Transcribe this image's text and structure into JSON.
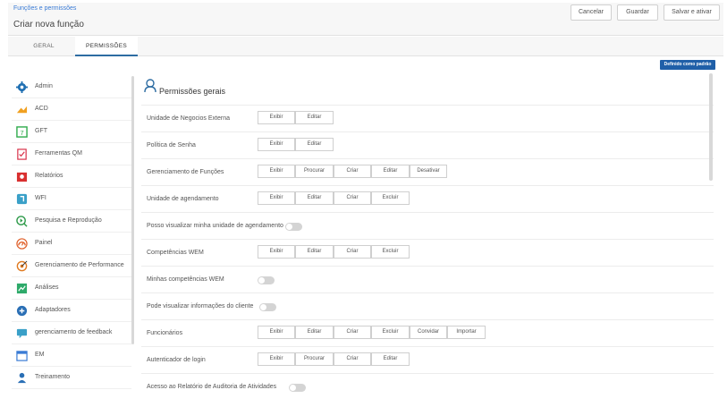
{
  "header": {
    "breadcrumb": "Funções e permissões",
    "title": "Criar nova função",
    "cancel_label": "Cancelar",
    "save_label": "Guardar",
    "save_activate_label": "Salvar e ativar"
  },
  "tabs": [
    {
      "label": "GERAL",
      "active": false
    },
    {
      "label": "PERMISSÕES",
      "active": true
    }
  ],
  "default_button": "Definido como padrão",
  "sidebar": {
    "items": [
      {
        "label": "Admin",
        "icon": "gear-icon",
        "color": "#1f6fb2"
      },
      {
        "label": "ACD",
        "icon": "acd-icon",
        "color": "#f0a020"
      },
      {
        "label": "GFT",
        "icon": "calendar-7-icon",
        "color": "#2eaa4a"
      },
      {
        "label": "Ferramentas QM",
        "icon": "checklist-icon",
        "color": "#d9324a"
      },
      {
        "label": "Relatórios",
        "icon": "report-icon",
        "color": "#d93030"
      },
      {
        "label": "WFI",
        "icon": "wfi-icon",
        "color": "#3aa0c8"
      },
      {
        "label": "Pesquisa e Reprodução",
        "icon": "search-play-icon",
        "color": "#2e9a4a"
      },
      {
        "label": "Painel",
        "icon": "dashboard-icon",
        "color": "#e0602a"
      },
      {
        "label": "Gerenciamento de Performance",
        "icon": "target-icon",
        "color": "#e07a20"
      },
      {
        "label": "Análises",
        "icon": "analytics-icon",
        "color": "#2eaa6a"
      },
      {
        "label": "Adaptadores",
        "icon": "adapter-icon",
        "color": "#2a6fb5"
      },
      {
        "label": "gerenciamento de feedback",
        "icon": "feedback-icon",
        "color": "#3aa0c8"
      },
      {
        "label": "EM",
        "icon": "em-icon",
        "color": "#3a7bd5"
      },
      {
        "label": "Treinamento",
        "icon": "training-icon",
        "color": "#2a6fb5"
      }
    ]
  },
  "main": {
    "section_title": "Permissões gerais",
    "rows": [
      {
        "label": "Unidade de Negocios Externa",
        "buttons": [
          "Exibir",
          "Editar"
        ]
      },
      {
        "label": "Política de Senha",
        "buttons": [
          "Exibir",
          "Editar"
        ]
      },
      {
        "label": "Gerenciamento de Funções",
        "buttons": [
          "Exibir",
          "Procurar",
          "Criar",
          "Editar",
          "Desativar"
        ]
      },
      {
        "label": "Unidade de agendamento",
        "buttons": [
          "Exibir",
          "Editar",
          "Criar",
          "Excluir"
        ]
      },
      {
        "label": "Posso visualizar minha unidade de agendamento",
        "toggle": true
      },
      {
        "label": "Competências WEM",
        "buttons": [
          "Exibir",
          "Editar",
          "Criar",
          "Excluir"
        ]
      },
      {
        "label": "Minhas competências WEM",
        "toggle": true
      },
      {
        "label": "Pode visualizar informações do cliente",
        "toggle": true
      },
      {
        "label": "Funcionários",
        "buttons": [
          "Exibir",
          "Editar",
          "Criar",
          "Excluir",
          "Convidar",
          "Importar"
        ]
      },
      {
        "label": "Autenticador de login",
        "buttons": [
          "Exibir",
          "Procurar",
          "Criar",
          "Editar"
        ]
      },
      {
        "label": "Acesso ao Relatório de Auditoria de Atividades",
        "toggle": true
      }
    ]
  }
}
